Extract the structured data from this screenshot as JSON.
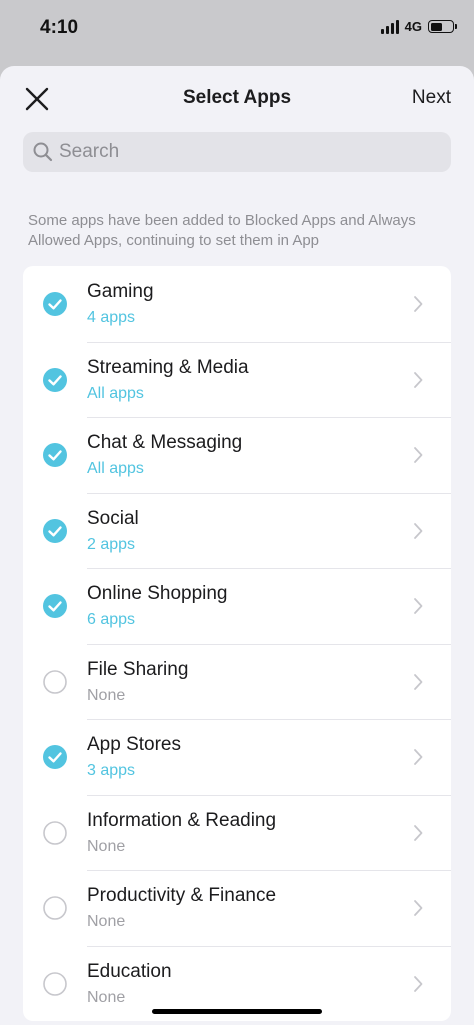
{
  "status": {
    "time": "4:10",
    "network": "4G",
    "battery_level": 0.55
  },
  "nav": {
    "title": "Select Apps",
    "next_label": "Next"
  },
  "search": {
    "placeholder": "Search"
  },
  "notice": "Some apps have been added to Blocked Apps and Always Allowed Apps, continuing to set them in App",
  "colors": {
    "accent": "#52c4e0",
    "checkbox_off": "#c7c7cc",
    "secondary_text": "#8e8e93"
  },
  "categories": [
    {
      "title": "Gaming",
      "subtitle": "4 apps",
      "checked": true
    },
    {
      "title": "Streaming & Media",
      "subtitle": "All apps",
      "checked": true
    },
    {
      "title": "Chat & Messaging",
      "subtitle": "All apps",
      "checked": true
    },
    {
      "title": "Social",
      "subtitle": "2 apps",
      "checked": true
    },
    {
      "title": "Online Shopping",
      "subtitle": "6 apps",
      "checked": true
    },
    {
      "title": "File Sharing",
      "subtitle": "None",
      "checked": false
    },
    {
      "title": "App Stores",
      "subtitle": "3 apps",
      "checked": true
    },
    {
      "title": "Information & Reading",
      "subtitle": "None",
      "checked": false
    },
    {
      "title": "Productivity & Finance",
      "subtitle": "None",
      "checked": false
    },
    {
      "title": "Education",
      "subtitle": "None",
      "checked": false
    }
  ]
}
